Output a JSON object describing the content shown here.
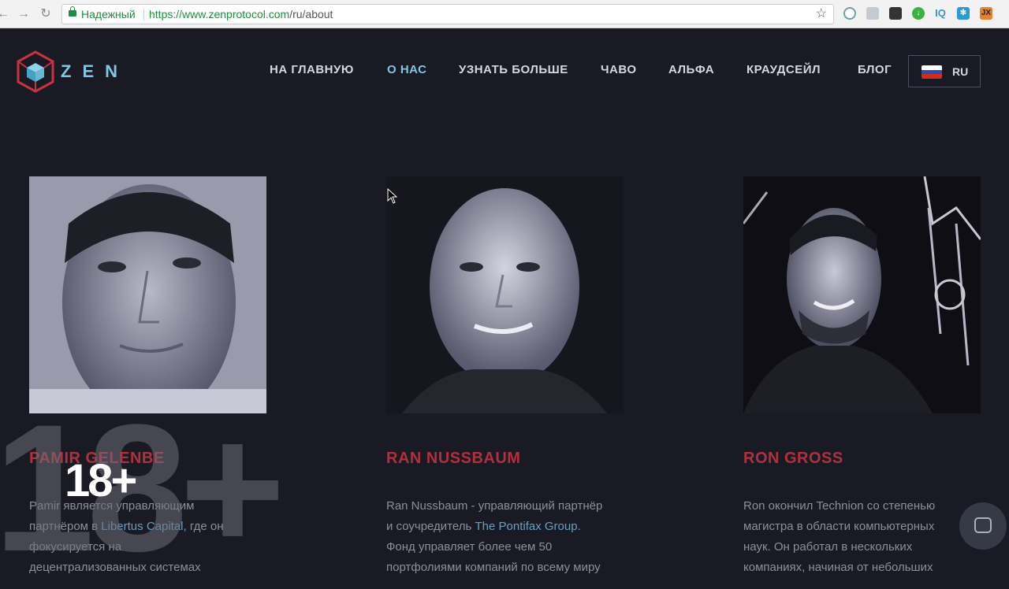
{
  "browser": {
    "secure_label": "Надежный",
    "url_host": "https://www.zenprotocol.com",
    "url_path": "/ru/about",
    "extensions": [
      {
        "name": "ext-1",
        "label": "",
        "color": "#6aa0a8"
      },
      {
        "name": "ext-2",
        "label": "",
        "color": "#b8bec8"
      },
      {
        "name": "ext-3",
        "label": "",
        "color": "#333333"
      },
      {
        "name": "ext-4",
        "label": "",
        "color": "#3cb043"
      },
      {
        "name": "ext-5",
        "label": "IQ",
        "color": "#3a8fd6"
      },
      {
        "name": "ext-6",
        "label": "",
        "color": "#2a9ad6"
      },
      {
        "name": "ext-7",
        "label": "JX",
        "color": "#e8812a"
      }
    ]
  },
  "site": {
    "logo_text": "ZEN",
    "nav": [
      {
        "label": "НА ГЛАВНУЮ",
        "active": false
      },
      {
        "label": "О НАС",
        "active": true
      },
      {
        "label": "УЗНАТЬ БОЛЬШЕ",
        "active": false
      },
      {
        "label": "ЧАВО",
        "active": false
      },
      {
        "label": "АЛЬФА",
        "active": false
      },
      {
        "label": "КРАУДСЕЙЛ",
        "active": false
      },
      {
        "label": "БЛОГ",
        "active": false
      }
    ],
    "language": "RU",
    "accent_color": "#7ec8e3",
    "name_color": "#b0303d"
  },
  "team": [
    {
      "name": "PAMIR GELENBE",
      "bio_lines": [
        "Pamir является управляющим",
        "партнёром в ",
        "фокусируется на",
        "децентрализованных системах"
      ],
      "link_text": "Libertus Capital",
      "link_suffix": ", где он"
    },
    {
      "name": "RAN NUSSBAUM",
      "bio_lines": [
        "Ran Nussbaum - управляющий партнёр",
        "и соучредитель ",
        "Фонд управляет более чем 50",
        "портфолиями компаний по всему миру"
      ],
      "link_text": "The Pontifax Group",
      "link_suffix": "."
    },
    {
      "name": "RON GROSS",
      "bio_lines": [
        "Ron окончил Technion со степенью",
        "магистра в области компьютерных",
        "наук. Он работал в нескольких",
        "компаниях, начиная от небольших"
      ],
      "link_text": "",
      "link_suffix": ""
    }
  ],
  "overlay": {
    "age_rating": "18+"
  }
}
